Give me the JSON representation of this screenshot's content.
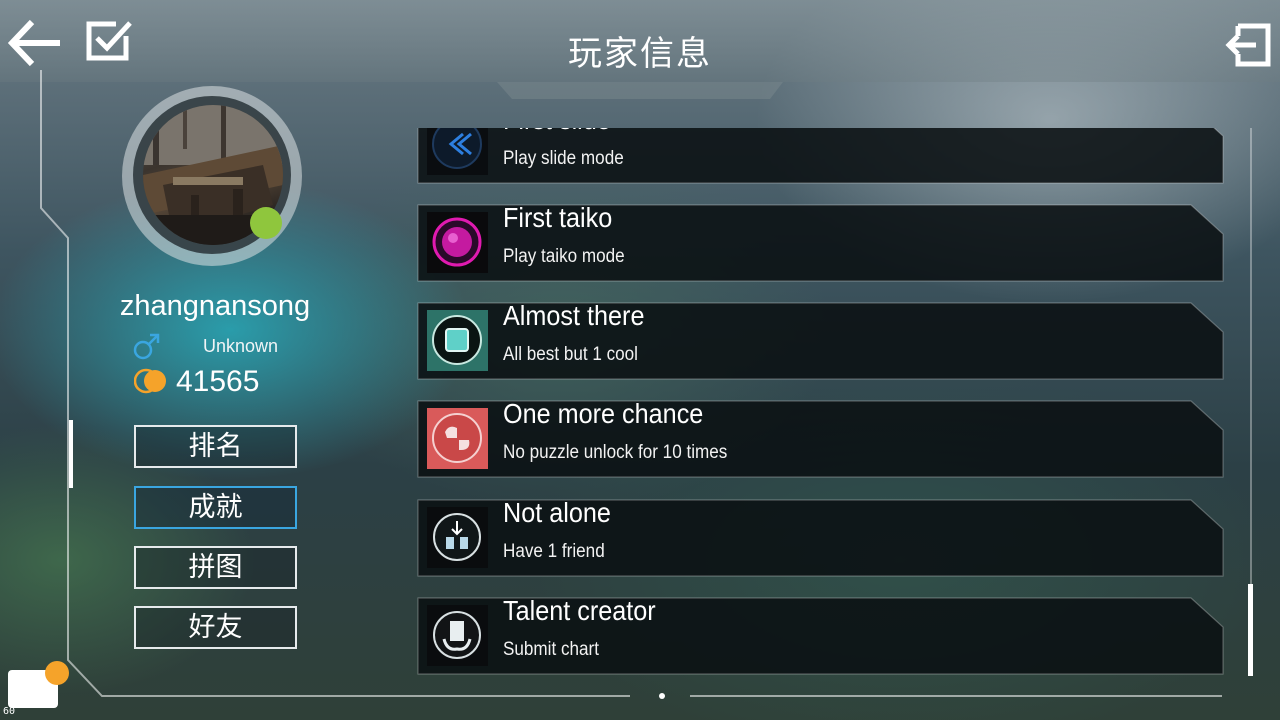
{
  "header": {
    "title": "玩家信息",
    "back_icon": "back-arrow-icon",
    "check_icon": "checkbox-icon",
    "exit_icon": "exit-icon"
  },
  "profile": {
    "username": "zhangnansong",
    "gender_icon": "male-icon",
    "gender_label": "Unknown",
    "coin_icon": "coin-icon",
    "coins": "41565",
    "online": true
  },
  "menu": [
    {
      "label": "排名",
      "active": false
    },
    {
      "label": "成就",
      "active": true
    },
    {
      "label": "拼图",
      "active": false
    },
    {
      "label": "好友",
      "active": false
    }
  ],
  "achievements": [
    {
      "title": "First slide",
      "desc": "Play slide mode",
      "icon": "slide-mode-icon"
    },
    {
      "title": "First taiko",
      "desc": "Play taiko mode",
      "icon": "taiko-mode-icon"
    },
    {
      "title": "Almost there",
      "desc": "All best but 1 cool",
      "icon": "almost-there-icon"
    },
    {
      "title": "One more chance",
      "desc": "No puzzle unlock for 10 times",
      "icon": "puzzle-chance-icon"
    },
    {
      "title": "Not alone",
      "desc": "Have 1 friend",
      "icon": "friend-icon"
    },
    {
      "title": "Talent creator",
      "desc": "Submit chart",
      "icon": "creator-icon"
    }
  ],
  "overlay": {
    "fps": "60",
    "chat_icon": "chat-icon"
  },
  "colors": {
    "accent_blue": "#3aa6e0",
    "online_green": "#8fc63d",
    "coin_orange": "#f5a32a",
    "card_bg": "#101618"
  }
}
